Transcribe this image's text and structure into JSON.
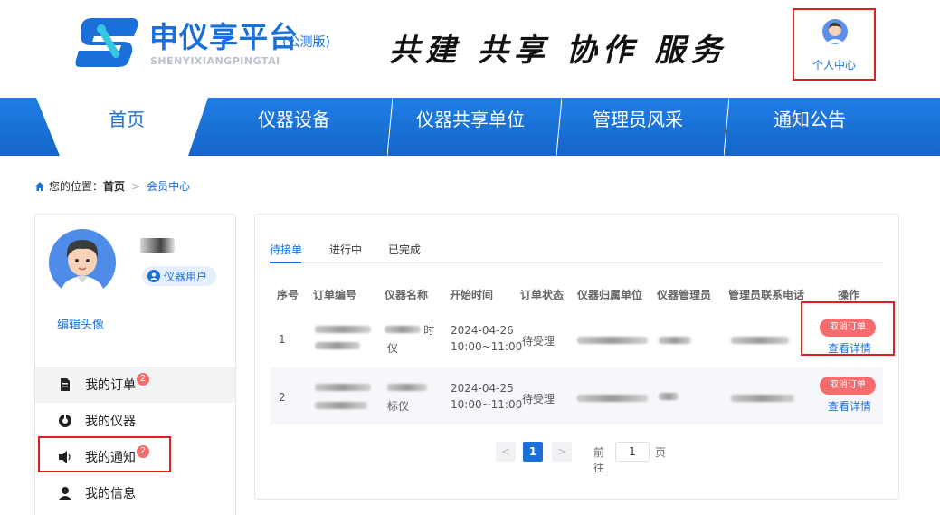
{
  "header": {
    "logo_title": "申仪享平台",
    "logo_badge": "(公测版)",
    "logo_sub": "SHENYIXIANGPINGTAI",
    "slogan": "共建 共享 协作 服务",
    "user_center_label": "个人中心"
  },
  "nav": {
    "items": [
      {
        "label": "首页",
        "active": true
      },
      {
        "label": "仪器设备"
      },
      {
        "label": "仪器共享单位"
      },
      {
        "label": "管理员风采"
      },
      {
        "label": "通知公告"
      }
    ]
  },
  "breadcrumb": {
    "prefix": "您的位置：",
    "home": "首页",
    "sep": ">",
    "current": "会员中心"
  },
  "sidebar": {
    "role": "仪器用户",
    "edit_avatar": "编辑头像",
    "menu": [
      {
        "label": "我的订单",
        "badge": "2",
        "icon": "order-icon",
        "active": true
      },
      {
        "label": "我的仪器",
        "badge": "",
        "icon": "instrument-icon"
      },
      {
        "label": "我的通知",
        "badge": "2",
        "icon": "speaker-icon"
      },
      {
        "label": "我的信息",
        "badge": "",
        "icon": "user-icon"
      }
    ]
  },
  "orders": {
    "tabs": [
      "待接单",
      "进行中",
      "已完成"
    ],
    "active_tab": "待接单",
    "columns": [
      "序号",
      "订单编号",
      "仪器名称",
      "开始时间",
      "订单状态",
      "仪器归属单位",
      "仪器管理员",
      "管理员联系电话",
      "操作"
    ],
    "rows": [
      {
        "index": "1",
        "name_tail": "仪",
        "name_mark": "时",
        "date": "2024-04-26",
        "time": "10:00~11:00",
        "status": "待受理"
      },
      {
        "index": "2",
        "name_tail": "标仪",
        "name_mark": "",
        "date": "2024-04-25",
        "time": "10:00~11:00",
        "status": "待受理"
      }
    ],
    "cancel_label": "取消订单",
    "detail_label": "查看详情"
  },
  "pager": {
    "prev": "<",
    "current": "1",
    "next": ">",
    "goto_prefix": "前往",
    "goto_value": "1",
    "goto_suffix": "页"
  },
  "colors": {
    "brand": "#1a6fd8",
    "nav": "#1f7ee6",
    "danger": "#f56c6c",
    "highlight": "#e02020"
  }
}
